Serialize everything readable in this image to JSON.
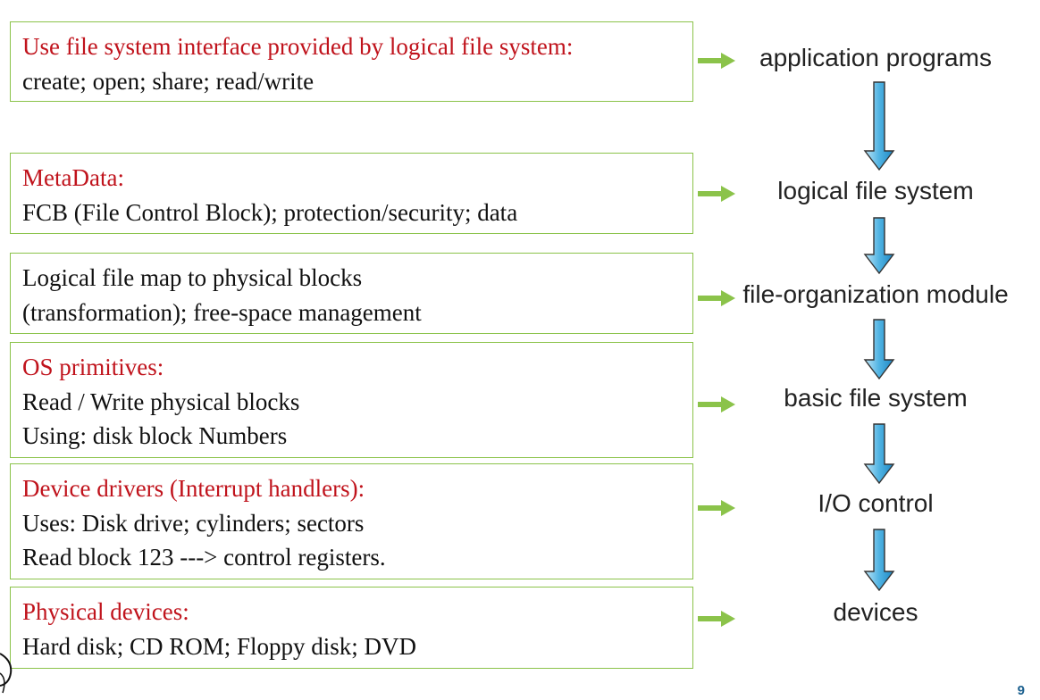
{
  "boxes": [
    {
      "lines": [
        {
          "text": "Use file system interface provided by logical file system:",
          "highlight": true
        },
        {
          "text": "create; open; share; read/write",
          "highlight": false
        }
      ]
    },
    {
      "lines": [
        {
          "text": "MetaData:",
          "highlight": true
        },
        {
          "text": "FCB (File Control Block); protection/security; data",
          "highlight": false
        }
      ]
    },
    {
      "lines": [
        {
          "text": "Logical file map to physical blocks",
          "highlight": false
        },
        {
          "text": "(transformation);  free-space management",
          "highlight": false
        }
      ]
    },
    {
      "lines": [
        {
          "text": "OS primitives:",
          "highlight": true
        },
        {
          "text": "Read / Write physical blocks",
          "highlight": false
        },
        {
          "text": "Using: disk block Numbers",
          "highlight": false
        }
      ]
    },
    {
      "lines": [
        {
          "text": "Device drivers (Interrupt handlers):",
          "highlight": true
        },
        {
          "text": "Uses: Disk drive; cylinders; sectors",
          "highlight": false
        },
        {
          "text": "Read block 123 ---> control registers.",
          "highlight": false
        }
      ]
    },
    {
      "lines": [
        {
          "text": "Physical devices:",
          "highlight": true
        },
        {
          "text": "Hard disk; CD ROM; Floppy disk; DVD",
          "highlight": false
        }
      ]
    }
  ],
  "layers": [
    "application programs",
    "logical file system",
    "file-organization module",
    "basic file system",
    "I/O control",
    "devices"
  ],
  "page_number": "9",
  "colors": {
    "highlight_text": "#c0131c",
    "box_border": "#8bc34a",
    "connector_arrow": "#8bc34a",
    "down_arrow_fill": "#4fb3e3",
    "page_number": "#1a5f8e"
  },
  "icons": {
    "connector": "right-arrow-icon",
    "flow": "down-arrow-icon"
  }
}
